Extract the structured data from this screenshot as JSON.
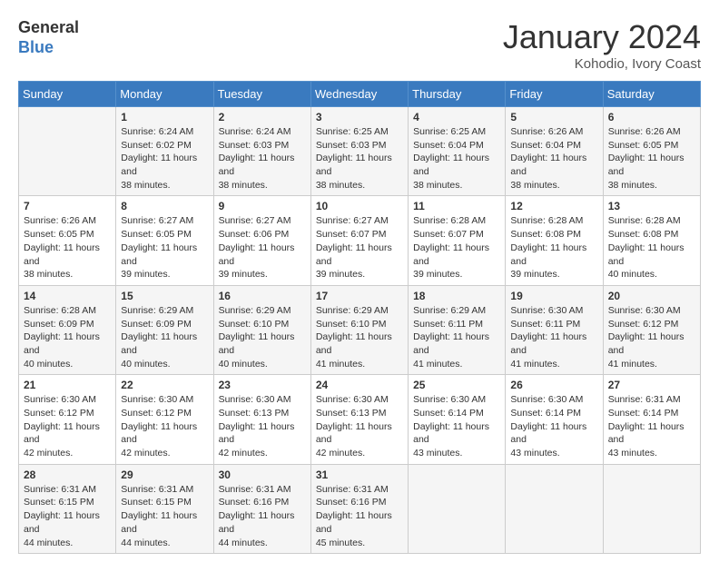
{
  "header": {
    "logo_line1": "General",
    "logo_line2": "Blue",
    "month": "January 2024",
    "location": "Kohodio, Ivory Coast"
  },
  "weekdays": [
    "Sunday",
    "Monday",
    "Tuesday",
    "Wednesday",
    "Thursday",
    "Friday",
    "Saturday"
  ],
  "weeks": [
    [
      {
        "day": "",
        "sunrise": "",
        "sunset": "",
        "daylight": ""
      },
      {
        "day": "1",
        "sunrise": "Sunrise: 6:24 AM",
        "sunset": "Sunset: 6:02 PM",
        "daylight": "Daylight: 11 hours and 38 minutes."
      },
      {
        "day": "2",
        "sunrise": "Sunrise: 6:24 AM",
        "sunset": "Sunset: 6:03 PM",
        "daylight": "Daylight: 11 hours and 38 minutes."
      },
      {
        "day": "3",
        "sunrise": "Sunrise: 6:25 AM",
        "sunset": "Sunset: 6:03 PM",
        "daylight": "Daylight: 11 hours and 38 minutes."
      },
      {
        "day": "4",
        "sunrise": "Sunrise: 6:25 AM",
        "sunset": "Sunset: 6:04 PM",
        "daylight": "Daylight: 11 hours and 38 minutes."
      },
      {
        "day": "5",
        "sunrise": "Sunrise: 6:26 AM",
        "sunset": "Sunset: 6:04 PM",
        "daylight": "Daylight: 11 hours and 38 minutes."
      },
      {
        "day": "6",
        "sunrise": "Sunrise: 6:26 AM",
        "sunset": "Sunset: 6:05 PM",
        "daylight": "Daylight: 11 hours and 38 minutes."
      }
    ],
    [
      {
        "day": "7",
        "sunrise": "Sunrise: 6:26 AM",
        "sunset": "Sunset: 6:05 PM",
        "daylight": "Daylight: 11 hours and 38 minutes."
      },
      {
        "day": "8",
        "sunrise": "Sunrise: 6:27 AM",
        "sunset": "Sunset: 6:05 PM",
        "daylight": "Daylight: 11 hours and 39 minutes."
      },
      {
        "day": "9",
        "sunrise": "Sunrise: 6:27 AM",
        "sunset": "Sunset: 6:06 PM",
        "daylight": "Daylight: 11 hours and 39 minutes."
      },
      {
        "day": "10",
        "sunrise": "Sunrise: 6:27 AM",
        "sunset": "Sunset: 6:07 PM",
        "daylight": "Daylight: 11 hours and 39 minutes."
      },
      {
        "day": "11",
        "sunrise": "Sunrise: 6:28 AM",
        "sunset": "Sunset: 6:07 PM",
        "daylight": "Daylight: 11 hours and 39 minutes."
      },
      {
        "day": "12",
        "sunrise": "Sunrise: 6:28 AM",
        "sunset": "Sunset: 6:08 PM",
        "daylight": "Daylight: 11 hours and 39 minutes."
      },
      {
        "day": "13",
        "sunrise": "Sunrise: 6:28 AM",
        "sunset": "Sunset: 6:08 PM",
        "daylight": "Daylight: 11 hours and 40 minutes."
      }
    ],
    [
      {
        "day": "14",
        "sunrise": "Sunrise: 6:28 AM",
        "sunset": "Sunset: 6:09 PM",
        "daylight": "Daylight: 11 hours and 40 minutes."
      },
      {
        "day": "15",
        "sunrise": "Sunrise: 6:29 AM",
        "sunset": "Sunset: 6:09 PM",
        "daylight": "Daylight: 11 hours and 40 minutes."
      },
      {
        "day": "16",
        "sunrise": "Sunrise: 6:29 AM",
        "sunset": "Sunset: 6:10 PM",
        "daylight": "Daylight: 11 hours and 40 minutes."
      },
      {
        "day": "17",
        "sunrise": "Sunrise: 6:29 AM",
        "sunset": "Sunset: 6:10 PM",
        "daylight": "Daylight: 11 hours and 41 minutes."
      },
      {
        "day": "18",
        "sunrise": "Sunrise: 6:29 AM",
        "sunset": "Sunset: 6:11 PM",
        "daylight": "Daylight: 11 hours and 41 minutes."
      },
      {
        "day": "19",
        "sunrise": "Sunrise: 6:30 AM",
        "sunset": "Sunset: 6:11 PM",
        "daylight": "Daylight: 11 hours and 41 minutes."
      },
      {
        "day": "20",
        "sunrise": "Sunrise: 6:30 AM",
        "sunset": "Sunset: 6:12 PM",
        "daylight": "Daylight: 11 hours and 41 minutes."
      }
    ],
    [
      {
        "day": "21",
        "sunrise": "Sunrise: 6:30 AM",
        "sunset": "Sunset: 6:12 PM",
        "daylight": "Daylight: 11 hours and 42 minutes."
      },
      {
        "day": "22",
        "sunrise": "Sunrise: 6:30 AM",
        "sunset": "Sunset: 6:12 PM",
        "daylight": "Daylight: 11 hours and 42 minutes."
      },
      {
        "day": "23",
        "sunrise": "Sunrise: 6:30 AM",
        "sunset": "Sunset: 6:13 PM",
        "daylight": "Daylight: 11 hours and 42 minutes."
      },
      {
        "day": "24",
        "sunrise": "Sunrise: 6:30 AM",
        "sunset": "Sunset: 6:13 PM",
        "daylight": "Daylight: 11 hours and 42 minutes."
      },
      {
        "day": "25",
        "sunrise": "Sunrise: 6:30 AM",
        "sunset": "Sunset: 6:14 PM",
        "daylight": "Daylight: 11 hours and 43 minutes."
      },
      {
        "day": "26",
        "sunrise": "Sunrise: 6:30 AM",
        "sunset": "Sunset: 6:14 PM",
        "daylight": "Daylight: 11 hours and 43 minutes."
      },
      {
        "day": "27",
        "sunrise": "Sunrise: 6:31 AM",
        "sunset": "Sunset: 6:14 PM",
        "daylight": "Daylight: 11 hours and 43 minutes."
      }
    ],
    [
      {
        "day": "28",
        "sunrise": "Sunrise: 6:31 AM",
        "sunset": "Sunset: 6:15 PM",
        "daylight": "Daylight: 11 hours and 44 minutes."
      },
      {
        "day": "29",
        "sunrise": "Sunrise: 6:31 AM",
        "sunset": "Sunset: 6:15 PM",
        "daylight": "Daylight: 11 hours and 44 minutes."
      },
      {
        "day": "30",
        "sunrise": "Sunrise: 6:31 AM",
        "sunset": "Sunset: 6:16 PM",
        "daylight": "Daylight: 11 hours and 44 minutes."
      },
      {
        "day": "31",
        "sunrise": "Sunrise: 6:31 AM",
        "sunset": "Sunset: 6:16 PM",
        "daylight": "Daylight: 11 hours and 45 minutes."
      },
      {
        "day": "",
        "sunrise": "",
        "sunset": "",
        "daylight": ""
      },
      {
        "day": "",
        "sunrise": "",
        "sunset": "",
        "daylight": ""
      },
      {
        "day": "",
        "sunrise": "",
        "sunset": "",
        "daylight": ""
      }
    ]
  ]
}
